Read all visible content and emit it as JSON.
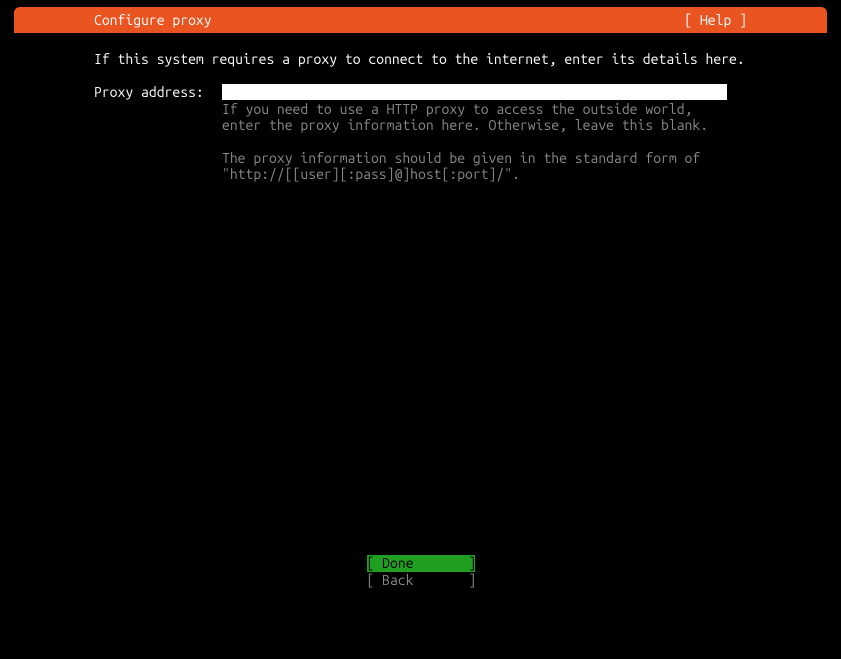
{
  "titlebar": {
    "title": "Configure proxy",
    "help_label": "[ Help ]"
  },
  "content": {
    "description": "If this system requires a proxy to connect to the internet, enter its details here.",
    "field_label": "Proxy address:",
    "input_value": "",
    "help_text_1": "If you need to use a HTTP proxy to access the outside world, enter the proxy information here. Otherwise, leave this blank.",
    "help_text_2": "The proxy information should be given in the standard form of \"http://[[user][:pass]@]host[:port]/\"."
  },
  "buttons": {
    "done_label": "[ Done       ]",
    "back_label": "[ Back       ]"
  }
}
